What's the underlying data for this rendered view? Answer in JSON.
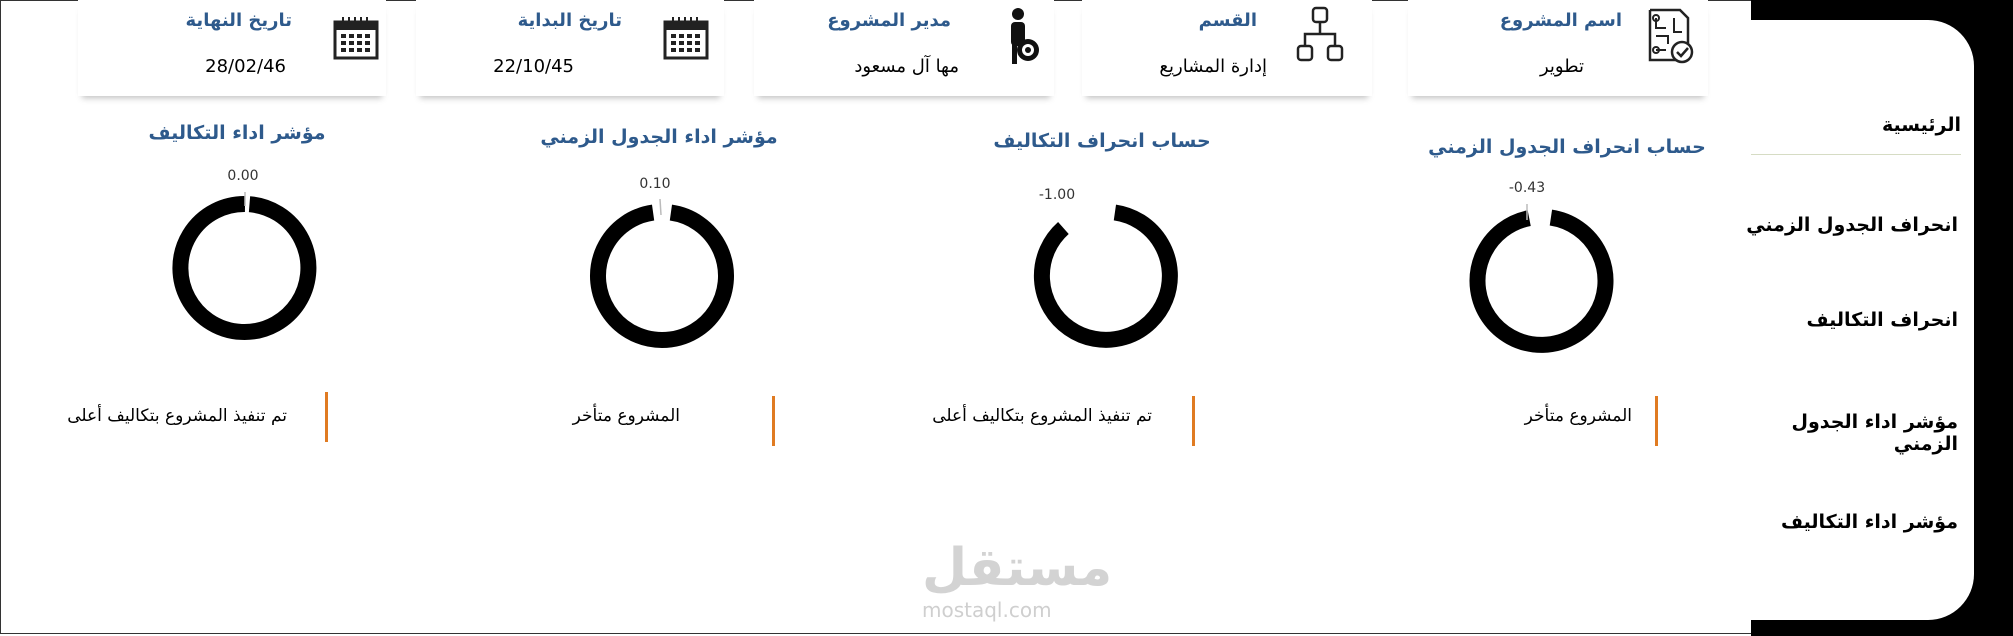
{
  "nav": {
    "items": [
      {
        "label": "الرئيسية"
      },
      {
        "label": "انحراف الجدول الزمني"
      },
      {
        "label": "انحراف التكاليف"
      },
      {
        "label": "مؤشر اداء الجدول الزمني"
      },
      {
        "label": "مؤشر اداء التكاليف"
      }
    ]
  },
  "header": {
    "project_name": {
      "label": "اسم المشروع",
      "value": "تطوير",
      "icon": "circuit-board-check-icon"
    },
    "department": {
      "label": "القسم",
      "value": "إدارة المشاريع",
      "icon": "hierarchy-icon"
    },
    "manager": {
      "label": "مدير المشروع",
      "value": "مها آل مسعود",
      "icon": "person-gear-icon"
    },
    "start_date": {
      "label": "تاريخ البداية",
      "value": "22/10/45",
      "icon": "calendar-icon"
    },
    "end_date": {
      "label": "تاريخ النهاية",
      "value": "28/02/46",
      "icon": "calendar-icon"
    }
  },
  "kpis": [
    {
      "title": "حساب انحراف الجدول الزمني",
      "value": "-0.43",
      "status": "المشروع متأخر"
    },
    {
      "title": "حساب انحراف التكاليف",
      "value": "-1.00",
      "status": "تم تنفيذ المشروع بتكاليف أعلى"
    },
    {
      "title": "مؤشر اداء الجدول الزمني",
      "value": "0.10",
      "status": "المشروع متأخر"
    },
    {
      "title": "مؤشر اداء التكاليف",
      "value": "0.00",
      "status": "تم تنفيذ المشروع بتكاليف أعلى"
    }
  ],
  "watermark": {
    "arabic": "مستقل",
    "latin": "mostaql.com"
  },
  "colors": {
    "accent_blue": "#2e5a8c",
    "status_orange": "#e07b22",
    "nav_black": "#000000"
  }
}
